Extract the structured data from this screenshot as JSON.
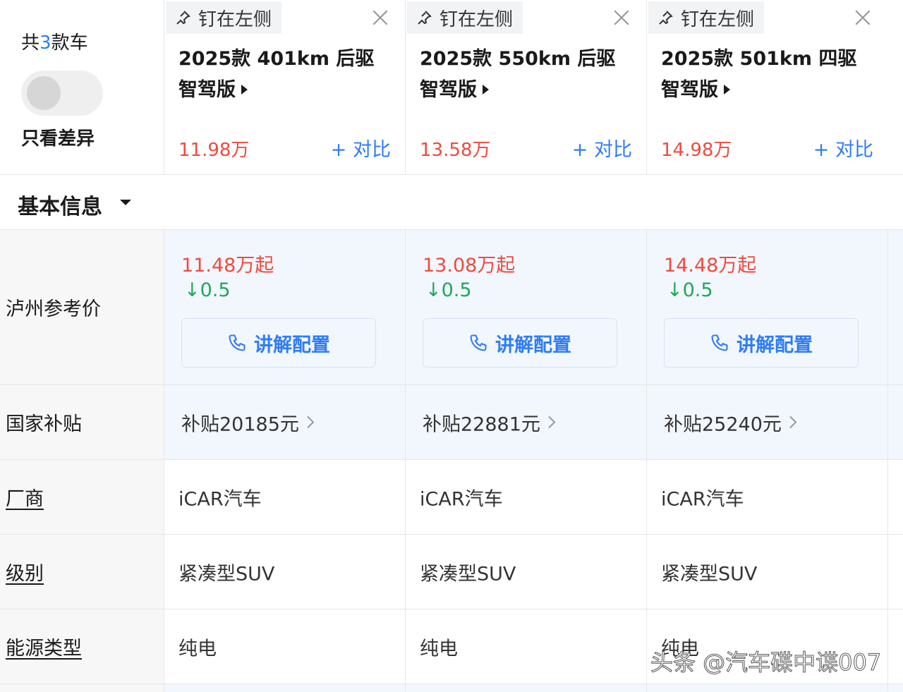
{
  "header": {
    "count_prefix": "共",
    "count_num": "3",
    "count_suffix": "款车",
    "toggle_label": "只看差异",
    "cars": [
      {
        "pin": "钉在左侧",
        "name": "2025款 401km 后驱 智驾版",
        "price": "11.98万",
        "compare": "+ 对比"
      },
      {
        "pin": "钉在左侧",
        "name": "2025款 550km 后驱 智驾版",
        "price": "13.58万",
        "compare": "+ 对比"
      },
      {
        "pin": "钉在左侧",
        "name": "2025款 501km 四驱 智驾版",
        "price": "14.98万",
        "compare": "+ 对比"
      }
    ]
  },
  "section": {
    "title": "基本信息"
  },
  "rows": {
    "ref_price": {
      "label": "泸州参考价",
      "cells": [
        {
          "price": "11.48万起",
          "drop": "↓0.5",
          "button": "讲解配置"
        },
        {
          "price": "13.08万起",
          "drop": "↓0.5",
          "button": "讲解配置"
        },
        {
          "price": "14.48万起",
          "drop": "↓0.5",
          "button": "讲解配置"
        }
      ]
    },
    "subsidy": {
      "label": "国家补贴",
      "cells": [
        "补贴20185元",
        "补贴22881元",
        "补贴25240元"
      ]
    },
    "maker": {
      "label": "厂商",
      "cells": [
        "iCAR汽车",
        "iCAR汽车",
        "iCAR汽车"
      ]
    },
    "level": {
      "label": "级别",
      "cells": [
        "紧凑型SUV",
        "紧凑型SUV",
        "紧凑型SUV"
      ]
    },
    "energy": {
      "label": "能源类型",
      "cells": [
        "纯电",
        "纯电",
        "纯电"
      ]
    }
  },
  "watermark": "头条 @汽车碟中谍007",
  "colors": {
    "accent": "#2f7cf6",
    "price_red": "#f04a3e",
    "drop_green": "#1fa857",
    "highlight_bg": "#f2f7fd"
  }
}
